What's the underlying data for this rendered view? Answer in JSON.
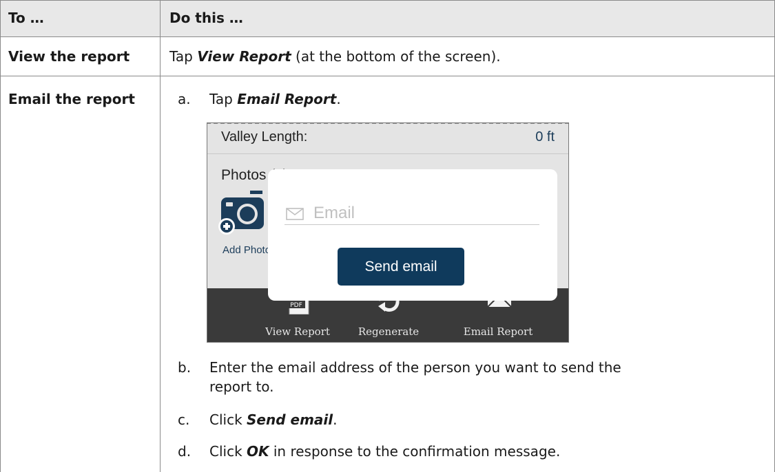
{
  "header": {
    "col1": "To …",
    "col2": "Do this …"
  },
  "row_view": {
    "label": "View the report",
    "prefix": "Tap ",
    "action": "View Report",
    "suffix": " (at the bottom of the screen)."
  },
  "row_email": {
    "label": "Email the report",
    "steps": {
      "a": {
        "label": "a.",
        "prefix": "Tap ",
        "action": "Email Report",
        "suffix": "."
      },
      "b": {
        "label": "b.",
        "line1": "Enter the email address of the person you want to send the",
        "line2": "report to."
      },
      "c": {
        "label": "c.",
        "prefix": "Click ",
        "action": "Send email",
        "suffix": "."
      },
      "d": {
        "label": "d.",
        "prefix": "Click ",
        "action": "OK",
        "suffix": " in response to the confirmation message."
      }
    }
  },
  "screenshot": {
    "valley_label": "Valley Length:",
    "valley_value": "0 ft",
    "photos_label": "Photos (1)",
    "add_photo": "Add Photo",
    "email_placeholder": "Email",
    "send_button": "Send email",
    "bar": {
      "view": "View Report",
      "regen": "Regenerate",
      "email": "Email Report",
      "pdf": "PDF"
    },
    "colors": {
      "accent": "#0f3a5c",
      "bar": "#3a3a3a"
    }
  }
}
